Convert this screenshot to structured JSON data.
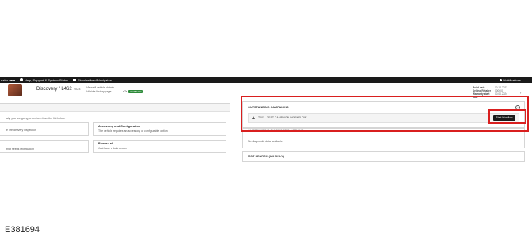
{
  "topbar": {
    "dealer": "ealer",
    "dealer_arrows": "◂▾ ▾",
    "help": "Help, Support & System Status",
    "nav": "Standardised Navigation",
    "notifications": "Notifications"
  },
  "vehicle": {
    "model": "Discovery / L462",
    "year": "2024",
    "link1": "View all vehicle details",
    "link2": "Vehicle history page",
    "vin_prefix": "eTs",
    "badge": "ENABLED",
    "meta": [
      {
        "key": "Build date",
        "value": "10.12.2023"
      },
      {
        "key": "Selling Retailer",
        "value": "000000"
      },
      {
        "key": "Warranty start date",
        "value": "00.00.2024"
      }
    ]
  },
  "left": {
    "instruction": "ally you are going to perform from the list below.",
    "card1_text": "e pre-delivery inspection",
    "card2_title": "Accessory and Configuration",
    "card2_text": "The vehicle requires an accessory or configurable option",
    "card3_text": "that needs rectification",
    "card4_title": "Browse all",
    "card4_text": "Just have a look around"
  },
  "right": {
    "campaigns_title": "OUTSTANDING CAMPAIGNS",
    "campaign_text": "T001 - TEST CAMPAIGN WORKFLOW",
    "start_button": "Start Workflow",
    "diagnostic_title": "OUTSTANDING DIAGNOSTIC ACTIONS",
    "diagnostic_text": "No diagnostic data available",
    "mot_title": "MOT SEARCH (UK ONLY)",
    "help_glyph": "?"
  },
  "caption": "E381694",
  "colors": {
    "highlight": "#d91f1f",
    "topbar": "#1a1a1a",
    "badge": "#2e8b3a"
  }
}
